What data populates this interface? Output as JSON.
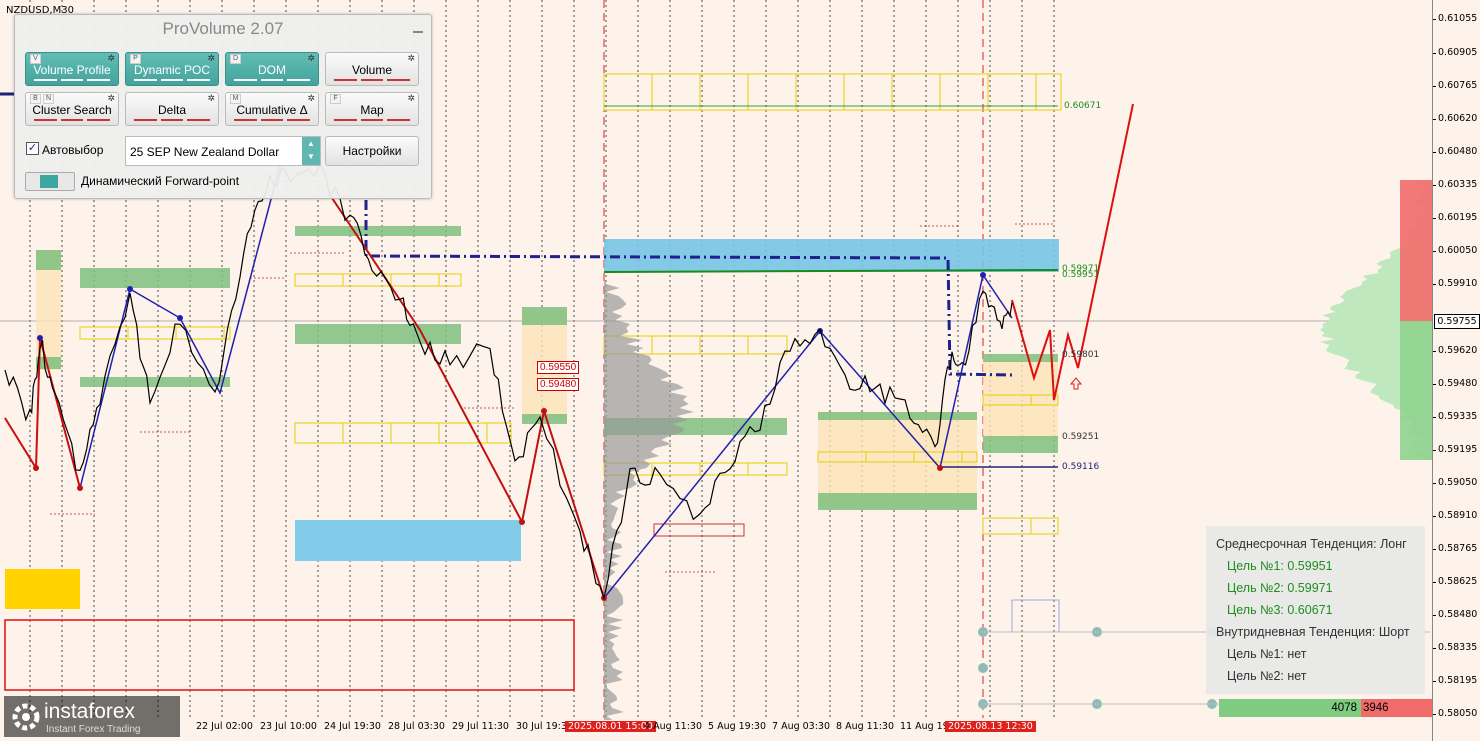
{
  "chart": {
    "symbol": "NZDUSD,M30",
    "price_ticks": [
      "0.61055",
      "0.60905",
      "0.60765",
      "0.60620",
      "0.60480",
      "0.60335",
      "0.60195",
      "0.60050",
      "0.59910",
      "0.59620",
      "0.59480",
      "0.59335",
      "0.59195",
      "0.59050",
      "0.58910",
      "0.58765",
      "0.58625",
      "0.58480",
      "0.58335",
      "0.58195",
      "0.58050"
    ],
    "current_price": "0.59755",
    "time_labels": [
      {
        "text": "22 Jul 02:00",
        "hl": false
      },
      {
        "text": "23 Jul 10:00",
        "hl": false
      },
      {
        "text": "24 Jul 19:30",
        "hl": false
      },
      {
        "text": "28 Jul 03:30",
        "hl": false
      },
      {
        "text": "29 Jul 11:30",
        "hl": false
      },
      {
        "text": "30 Jul 19:30",
        "hl": false
      },
      {
        "text": "2025.08.01 15:00",
        "hl": true
      },
      {
        "text": "4 Aug 11:30",
        "hl": false
      },
      {
        "text": "5 Aug 19:30",
        "hl": false
      },
      {
        "text": "7 Aug 03:30",
        "hl": false
      },
      {
        "text": "8 Aug 11:30",
        "hl": false
      },
      {
        "text": "11 Aug 19:",
        "hl": false
      },
      {
        "text": "2025.08.13 12:30",
        "hl": true
      }
    ],
    "level_labels": {
      "l1": "0.60671",
      "l2": "0.59971",
      "l3": "0.59951",
      "l4": "0.59801",
      "l5": "0.59251",
      "l6": "0.59116"
    },
    "poc_labels": {
      "p1": "0.59550",
      "p2": "0.59480"
    },
    "current_bid": "4078",
    "current_ask": "3946",
    "colors": {
      "bg": "#fdf3ea",
      "accent": "#4db3ac",
      "up": "#1f8d1f",
      "down": "#c00000"
    }
  },
  "panel": {
    "title": "ProVolume 2.07",
    "buttons": [
      {
        "label": "Volume Profile",
        "key": "V",
        "on": true
      },
      {
        "label": "Dynamic POC",
        "key": "P",
        "on": true
      },
      {
        "label": "DOM",
        "key": "D",
        "on": true
      },
      {
        "label": "Volume",
        "key": "",
        "on": false
      },
      {
        "label": "Cluster Search",
        "key": "B",
        "key2": "N",
        "on": false
      },
      {
        "label": "Delta",
        "key": "",
        "on": false
      },
      {
        "label": "Cumulative Δ",
        "key": "M",
        "on": false
      },
      {
        "label": "Map",
        "key": "F",
        "on": false
      }
    ],
    "autoselect_label": "Автовыбор",
    "instrument": "25 SEP New Zealand Dollar",
    "settings_label": "Настройки",
    "forward_label": "Динамический Forward-point"
  },
  "trend": {
    "mid_title": "Среднесрочная Тенденция: Лонг",
    "mid_t1": "Цель №1: 0.59951",
    "mid_t2": "Цель №2: 0.59971",
    "mid_t3": "Цель №3: 0.60671",
    "intra_title": "Внутридневная Тенденция: Шорт",
    "intra_t1": "Цель №1: нет",
    "intra_t2": "Цель №2: нет"
  },
  "logo": {
    "name": "instaforex",
    "tagline": "Instant Forex Trading"
  }
}
